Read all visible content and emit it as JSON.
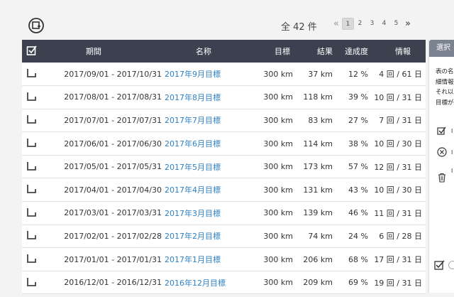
{
  "header": {
    "count_text": "全 42 件",
    "pagination": {
      "prev": "«",
      "pages": [
        "1",
        "2",
        "3",
        "4",
        "5"
      ],
      "current": "1",
      "next": "»"
    }
  },
  "table": {
    "columns": {
      "period": "期間",
      "name": "名称",
      "target": "目標",
      "result": "結果",
      "rate": "達成度",
      "info": "情報"
    },
    "rows": [
      {
        "period": "2017/09/01 - 2017/10/31",
        "name": "2017年9月目標",
        "target": "300 km",
        "result": "37 km",
        "rate": "12 %",
        "info": "4 回 / 61 日"
      },
      {
        "period": "2017/08/01 - 2017/08/31",
        "name": "2017年8月目標",
        "target": "300 km",
        "result": "118 km",
        "rate": "39 %",
        "info": "10 回 / 31 日"
      },
      {
        "period": "2017/07/01 - 2017/07/31",
        "name": "2017年7月目標",
        "target": "300 km",
        "result": "83 km",
        "rate": "27 %",
        "info": "7 回 / 31 日"
      },
      {
        "period": "2017/06/01 - 2017/06/30",
        "name": "2017年6月目標",
        "target": "300 km",
        "result": "114 km",
        "rate": "38 %",
        "info": "10 回 / 30 日"
      },
      {
        "period": "2017/05/01 - 2017/05/31",
        "name": "2017年5月目標",
        "target": "300 km",
        "result": "173 km",
        "rate": "57 %",
        "info": "12 回 / 31 日"
      },
      {
        "period": "2017/04/01 - 2017/04/30",
        "name": "2017年4月目標",
        "target": "300 km",
        "result": "131 km",
        "rate": "43 %",
        "info": "10 回 / 30 日"
      },
      {
        "period": "2017/03/01 - 2017/03/31",
        "name": "2017年3月目標",
        "target": "300 km",
        "result": "139 km",
        "rate": "46 %",
        "info": "11 回 / 31 日"
      },
      {
        "period": "2017/02/01 - 2017/02/28",
        "name": "2017年2月目標",
        "target": "300 km",
        "result": "74 km",
        "rate": "24 %",
        "info": "6 回 / 28 日"
      },
      {
        "period": "2017/01/01 - 2017/01/31",
        "name": "2017年1月目標",
        "target": "300 km",
        "result": "206 km",
        "rate": "68 %",
        "info": "17 回 / 31 日"
      },
      {
        "period": "2016/12/01 - 2016/12/31",
        "name": "2016年12月目標",
        "target": "300 km",
        "result": "209 km",
        "rate": "69 %",
        "info": "19 回 / 31 日"
      }
    ]
  },
  "side_panel": {
    "tab_label": "選択",
    "text_lines": [
      "表の名",
      "細情報",
      "それ以",
      "目標が"
    ],
    "item_marks": [
      "I",
      "I",
      "I"
    ]
  },
  "colors": {
    "header_bg": "#3c4150",
    "link": "#2f80c2",
    "side_tab_bg": "#7b8290"
  }
}
